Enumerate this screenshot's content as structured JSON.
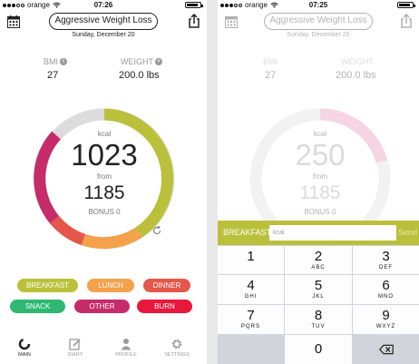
{
  "main_screen": {
    "status": {
      "carrier": "orange",
      "time": "07:26"
    },
    "plan_title": "Aggressive Weight Loss",
    "date": "Sunday, December 20",
    "bmi": {
      "label": "BMI",
      "value": "27",
      "info_icon": "i"
    },
    "weight": {
      "label": "WEIGHT",
      "value": "200.0 lbs",
      "add_icon": "+"
    },
    "kcal": {
      "unit": "kcal",
      "remaining": "1023",
      "from_label": "from",
      "goal": "1185",
      "bonus": "BONUS 0"
    },
    "meals": [
      {
        "label": "BREAKFAST",
        "color": "#bac03a"
      },
      {
        "label": "LUNCH",
        "color": "#f4a14b"
      },
      {
        "label": "DINNER",
        "color": "#e5574a"
      },
      {
        "label": "SNACK",
        "color": "#2eb872"
      },
      {
        "label": "OTHER",
        "color": "#c52c69"
      },
      {
        "label": "BURN",
        "color": "#e8183c"
      }
    ],
    "tabs": [
      {
        "label": "MAIN",
        "icon": "ring-icon",
        "active": true
      },
      {
        "label": "DIARY",
        "icon": "pencil-icon",
        "active": false
      },
      {
        "label": "PROFILE",
        "icon": "person-icon",
        "active": false
      },
      {
        "label": "SETTINGS",
        "icon": "gear-icon",
        "active": false
      }
    ]
  },
  "entry_screen": {
    "status": {
      "carrier": "orange",
      "time": "07:25"
    },
    "plan_title": "Aggressive Weight Loss",
    "date": "Sunday, December 20",
    "bmi": {
      "label": "BMI",
      "value": "27"
    },
    "weight": {
      "label": "WEIGHT",
      "value": "200.0 lbs"
    },
    "kcal": {
      "unit": "kcal",
      "remaining": "250",
      "from_label": "from",
      "goal": "1185",
      "bonus": "BONUS 0"
    },
    "entry_meal": "BREAKFAST",
    "input_placeholder": "kcal",
    "send_label": "Send",
    "keys": [
      {
        "num": "1",
        "letters": ""
      },
      {
        "num": "2",
        "letters": "ABC"
      },
      {
        "num": "3",
        "letters": "DEF"
      },
      {
        "num": "4",
        "letters": "GHI"
      },
      {
        "num": "5",
        "letters": "JKL"
      },
      {
        "num": "6",
        "letters": "MNO"
      },
      {
        "num": "7",
        "letters": "PQRS"
      },
      {
        "num": "8",
        "letters": "TUV"
      },
      {
        "num": "9",
        "letters": "WXYZ"
      },
      {
        "num": "0",
        "letters": ""
      }
    ]
  },
  "colors": {
    "breakfast": "#bac03a",
    "lunch": "#f4a14b",
    "dinner": "#e5574a",
    "snack": "#2eb872",
    "other": "#c52c69",
    "burn": "#e8183c",
    "ring_empty": "#dcdcdc",
    "entry_ring": "#f2c4d4"
  }
}
